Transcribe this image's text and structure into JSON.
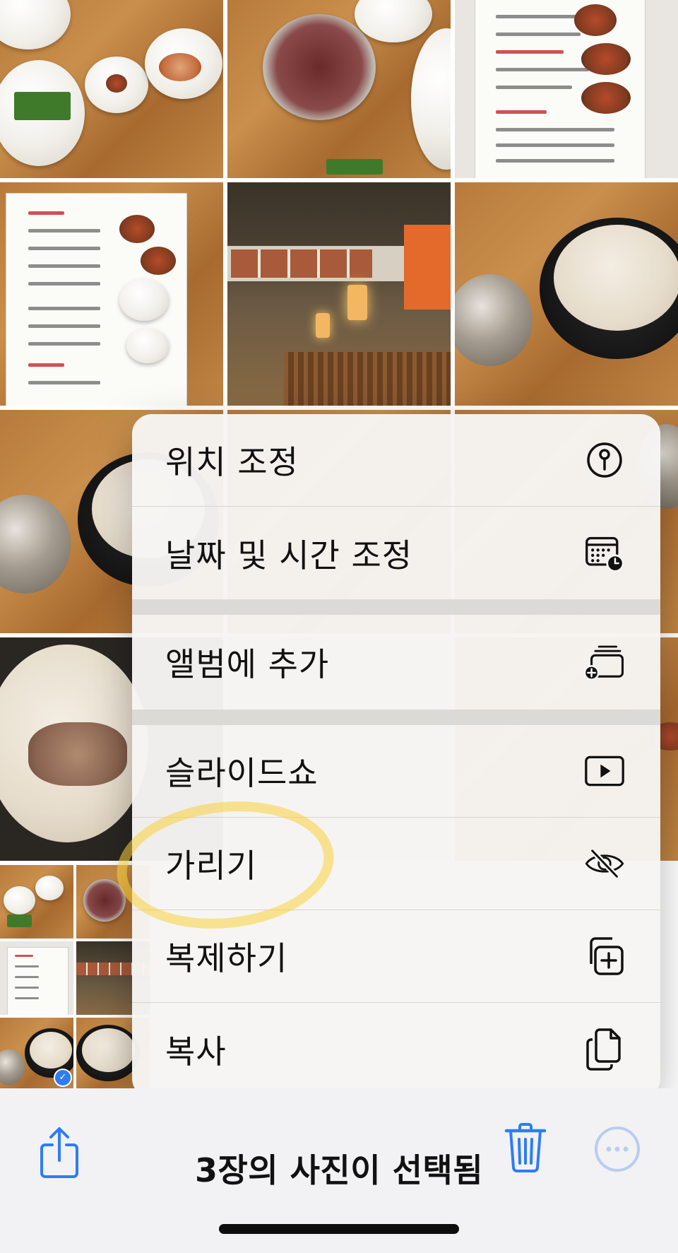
{
  "menu": {
    "items": [
      {
        "label": "위치 조정",
        "icon": "location-pin-icon"
      },
      {
        "label": "날짜 및 시간 조정",
        "icon": "calendar-clock-icon"
      },
      {
        "label": "앨범에 추가",
        "icon": "add-to-album-icon"
      },
      {
        "label": "슬라이드쇼",
        "icon": "play-slideshow-icon"
      },
      {
        "label": "가리기",
        "icon": "eye-slash-icon"
      },
      {
        "label": "복제하기",
        "icon": "duplicate-icon"
      },
      {
        "label": "복사",
        "icon": "copy-icon"
      }
    ]
  },
  "toolbar": {
    "selection_text": "3장의 사진이 선택됨",
    "share_icon": "share-icon",
    "trash_icon": "trash-icon",
    "more_icon": "more-ellipsis-icon"
  },
  "colors": {
    "accent": "#2f7cf6",
    "highlight": "#fad23c"
  }
}
